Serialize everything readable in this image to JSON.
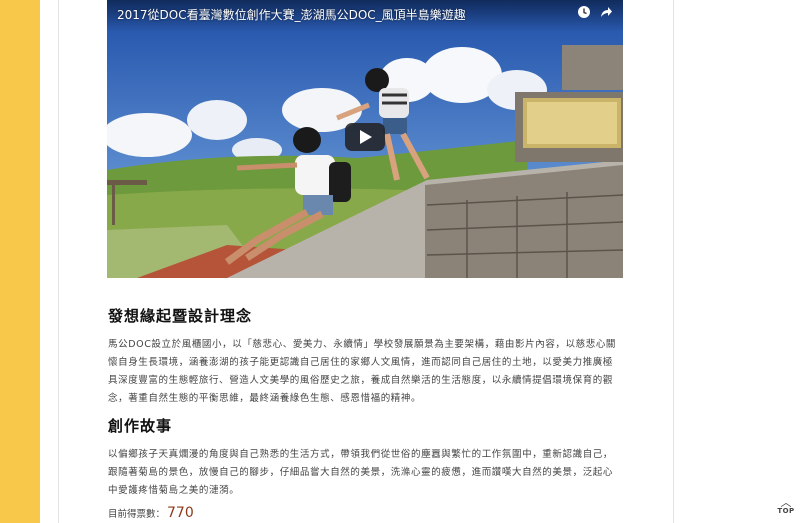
{
  "video": {
    "title": "2017從DOC看臺灣數位創作大賽_澎湖馬公DOC_風頂半島樂遊趣",
    "icons": [
      "clock-icon",
      "share-icon",
      "play-icon"
    ]
  },
  "section1": {
    "title": "發想緣起暨設計理念",
    "body": "馬公DOC設立於風櫃國小，以「慈悲心、愛美力、永續情」學校發展願景為主要架構，藉由影片內容，以慈悲心關懷自身生長環境，涵養澎湖的孩子能更認識自己居住的家鄉人文風情，進而認同自己居住的土地，以愛美力推廣極具深度豐富的生態輕旅行、營造人文美學的風俗歷史之旅，養成自然樂活的生活態度，以永續情提倡環境保育的觀念，著重自然生態的平衡思維，最終涵養綠色生態、感恩惜福的精神。"
  },
  "section2": {
    "title": "創作故事",
    "body": "以偏鄉孩子天真爛漫的角度與自己熟悉的生活方式，帶領我們從世俗的塵囂與繁忙的工作氛圍中，重新認識自己，跟隨著菊島的景色，放慢自己的腳步，仔細品嘗大自然的美景，洗滌心靈的疲憊，進而讚嘆大自然的美景，泛起心中愛護疼惜菊島之美的漣漪。"
  },
  "score": {
    "label": "目前得票數：",
    "value": "770"
  },
  "top_button": {
    "label": "TOP"
  },
  "colors": {
    "stripe": "#f7c84a",
    "score": "#8b3a1a"
  }
}
